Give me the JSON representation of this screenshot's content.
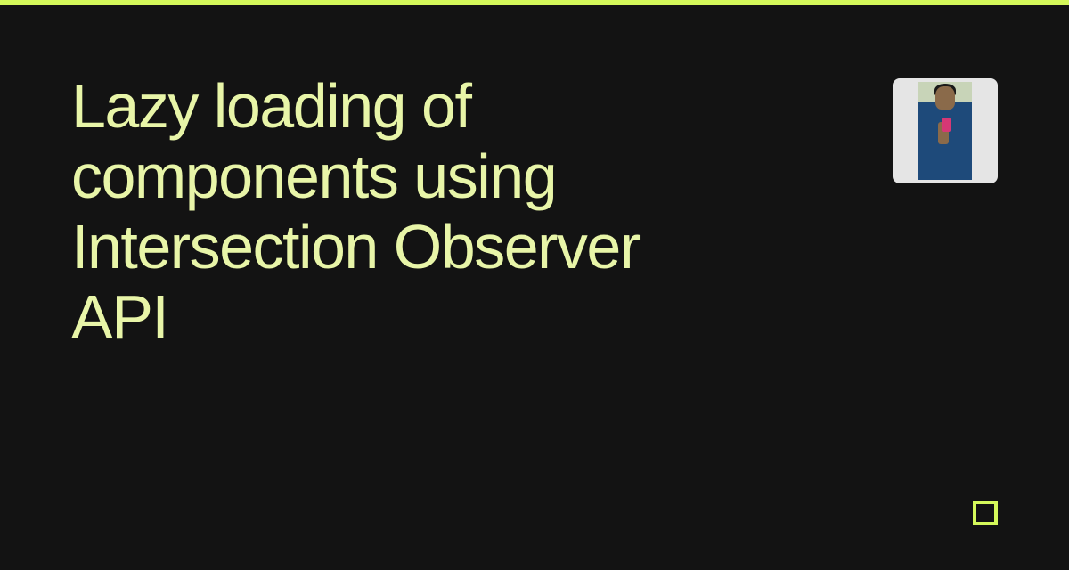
{
  "title": "Lazy loading of components using Intersection Observer API",
  "colors": {
    "accent": "#d4f85a",
    "titleColor": "#e8f5a8",
    "background": "#131313"
  }
}
